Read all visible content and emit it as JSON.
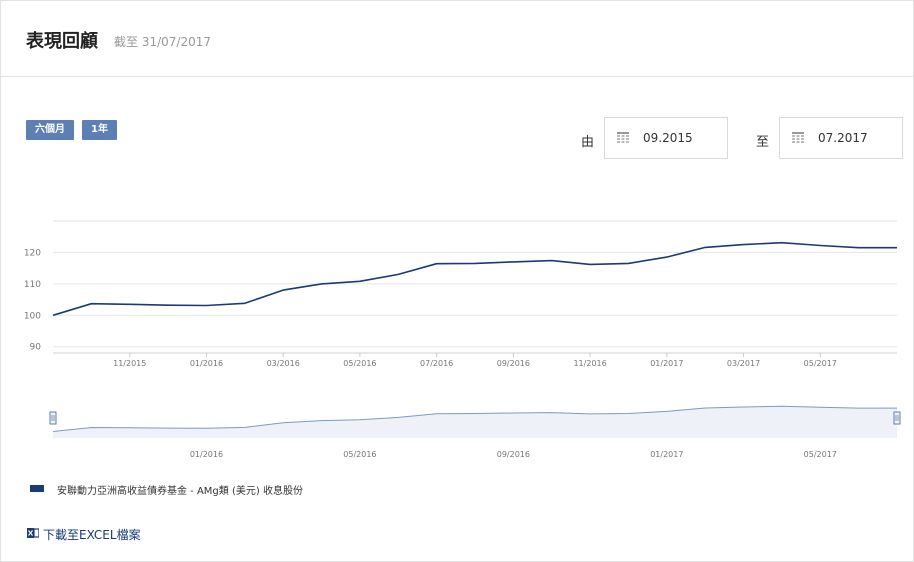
{
  "header": {
    "title": "表現回顧",
    "as_of": "截至 31/07/2017"
  },
  "range_buttons": {
    "six_months": "六個月",
    "one_year": "1年"
  },
  "date_range": {
    "from_label": "由",
    "from_value": "09.2015",
    "to_label": "至",
    "to_value": "07.2017"
  },
  "legend": {
    "series_name": "安聯動力亞洲高收益債券基金 - AMg類 (美元) 收息股份"
  },
  "download": {
    "label": "下載至EXCEL檔案"
  },
  "colors": {
    "line": "#1a3a78",
    "button": "#5d7fb4",
    "navigator_fill": "#eef1f7"
  },
  "chart_data": {
    "type": "line",
    "xlabel": "",
    "ylabel": "",
    "x_ticks": [
      "11/2015",
      "01/2016",
      "03/2016",
      "05/2016",
      "07/2016",
      "09/2016",
      "11/2016",
      "01/2017",
      "03/2017",
      "05/2017"
    ],
    "y_ticks": [
      90,
      100,
      110,
      120
    ],
    "ylim": [
      88,
      130
    ],
    "grid": true,
    "series": [
      {
        "name": "安聯動力亞洲高收益債券基金 - AMg類 (美元) 收息股份",
        "x": [
          "09/2015",
          "10/2015",
          "11/2015",
          "12/2015",
          "01/2016",
          "02/2016",
          "03/2016",
          "04/2016",
          "05/2016",
          "06/2016",
          "07/2016",
          "08/2016",
          "09/2016",
          "10/2016",
          "11/2016",
          "12/2016",
          "01/2017",
          "02/2017",
          "03/2017",
          "04/2017",
          "05/2017",
          "06/2017",
          "07/2017"
        ],
        "values": [
          100.0,
          103.7,
          103.5,
          103.2,
          103.1,
          103.8,
          108.0,
          110.0,
          110.8,
          113.0,
          116.4,
          116.5,
          117.0,
          117.4,
          116.2,
          116.5,
          118.5,
          121.6,
          122.5,
          123.1,
          122.2,
          121.5,
          121.5
        ]
      }
    ],
    "navigator": {
      "x_ticks": [
        "01/2016",
        "05/2016",
        "09/2016",
        "01/2017",
        "05/2017"
      ]
    }
  }
}
